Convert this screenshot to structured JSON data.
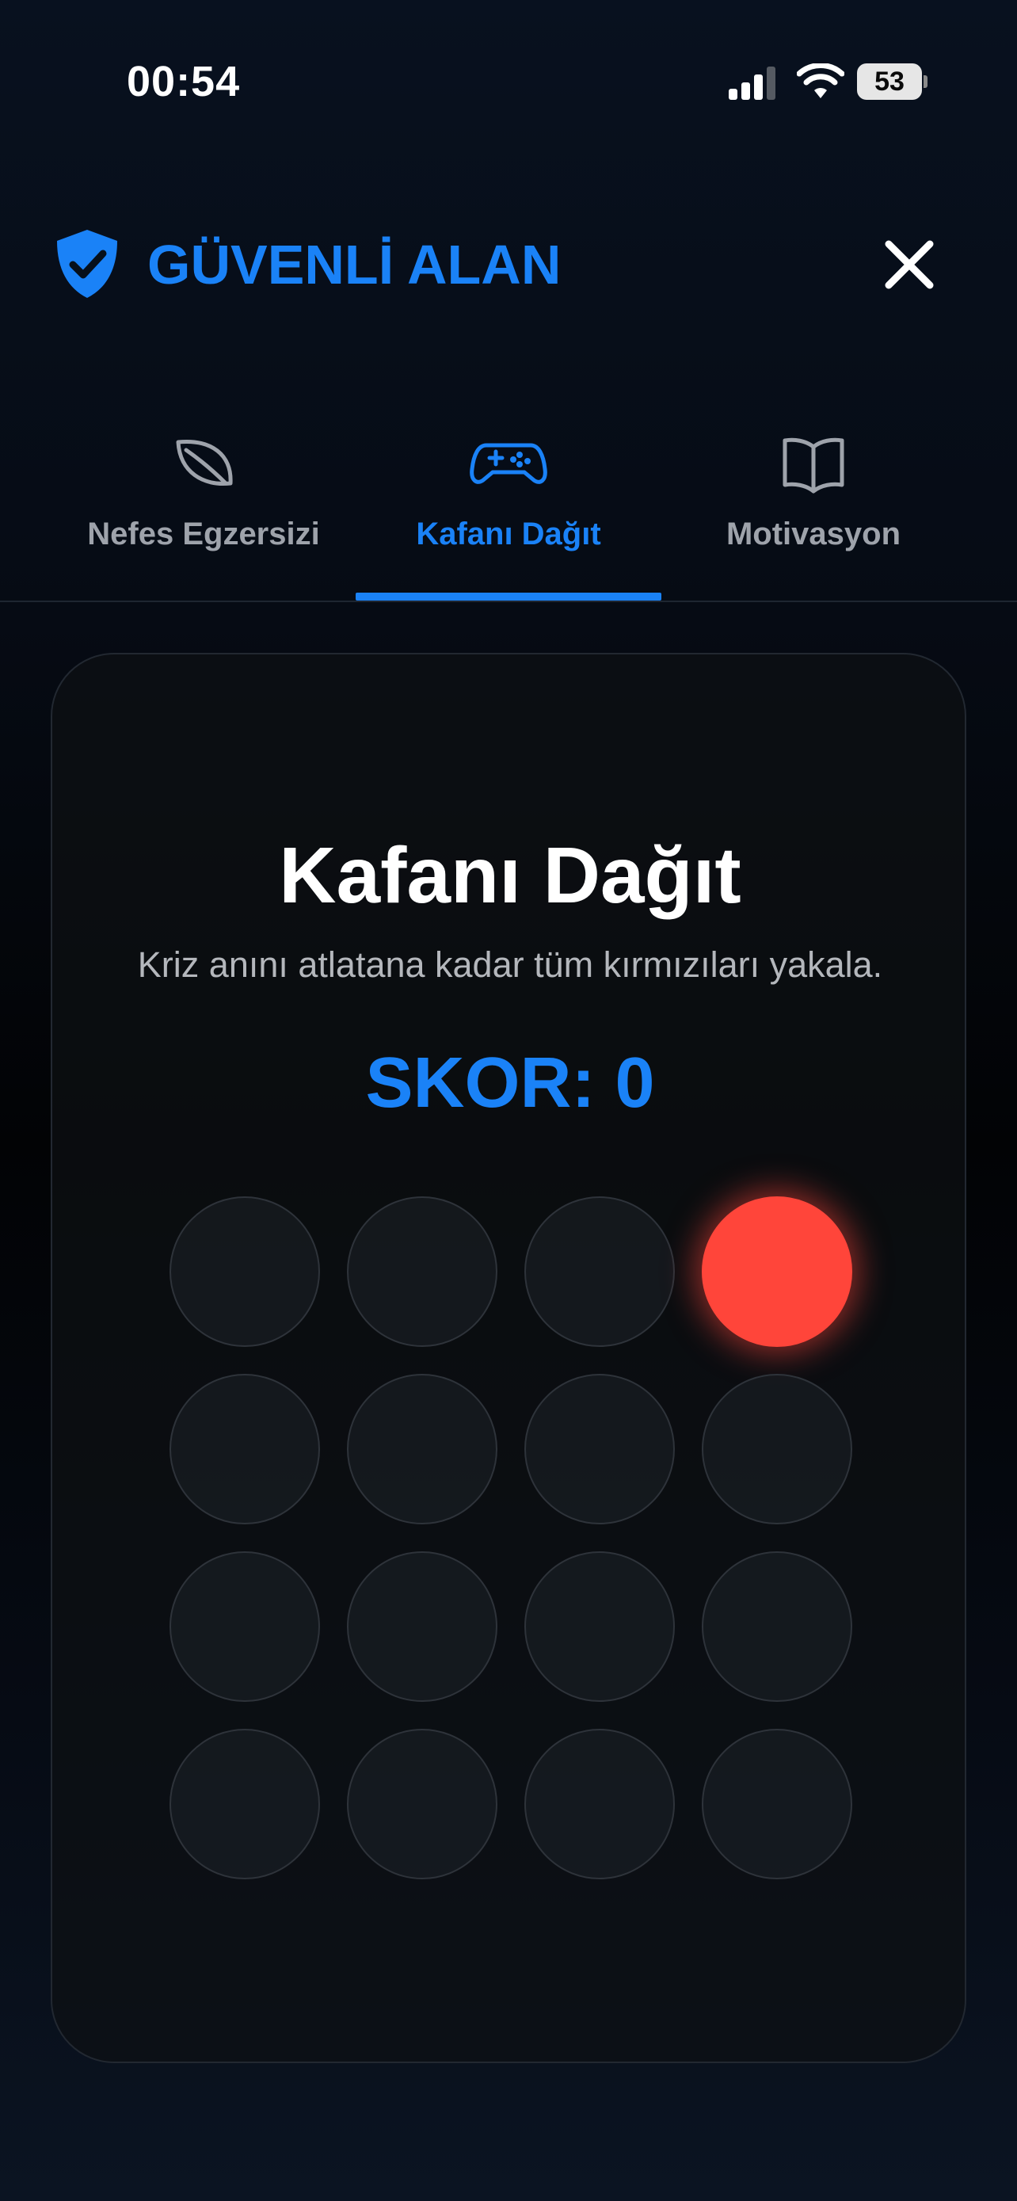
{
  "status_bar": {
    "time": "00:54",
    "battery": "53",
    "icons": [
      "signal-icon",
      "wifi-icon",
      "battery-icon"
    ]
  },
  "header": {
    "title": "GÜVENLİ ALAN",
    "icon": "shield-check-icon",
    "close_icon": "close-icon"
  },
  "tabs": [
    {
      "label": "Nefes Egzersizi",
      "icon": "leaf-icon",
      "active": false
    },
    {
      "label": "Kafanı Dağıt",
      "icon": "gamepad-icon",
      "active": true
    },
    {
      "label": "Motivasyon",
      "icon": "book-icon",
      "active": false
    }
  ],
  "game": {
    "title": "Kafanı Dağıt",
    "subtitle": "Kriz anını atlatana kadar tüm kırmızıları yakala.",
    "score": "SKOR: 0",
    "grid": {
      "rows": 4,
      "cols": 4,
      "active_cells": [
        {
          "row": 1,
          "col": 4
        }
      ]
    }
  },
  "colors": {
    "accent": "#1a82f7",
    "target": "#ff453a",
    "inactive_tab": "#9ea3ab"
  }
}
